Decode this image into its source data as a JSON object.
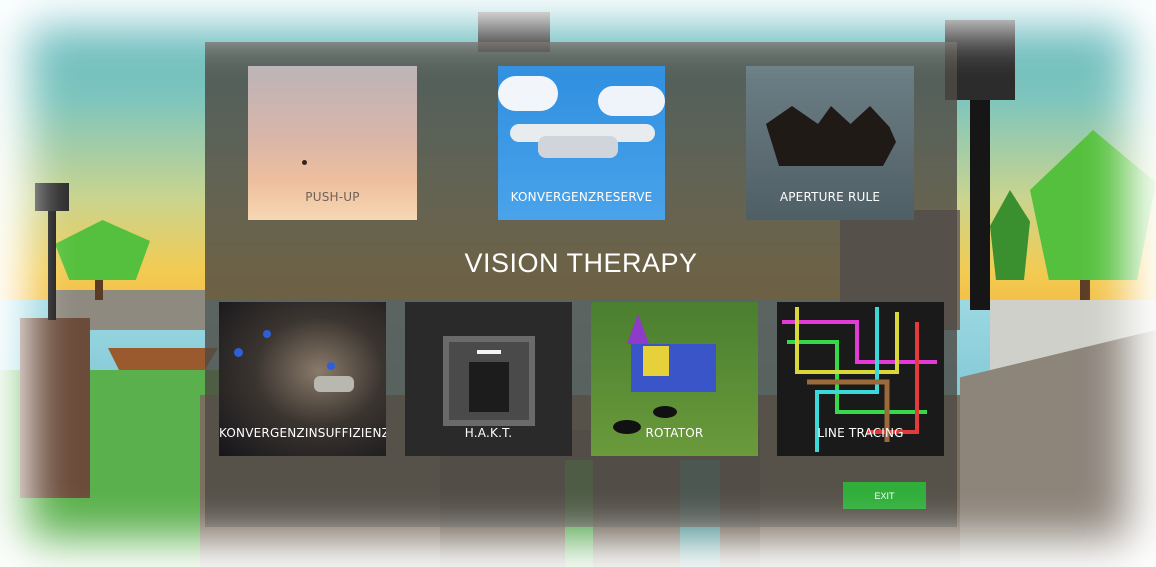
{
  "menu": {
    "title": "VISION THERAPY",
    "exit_label": "EXIT",
    "games_top": [
      {
        "label": "PUSH-UP"
      },
      {
        "label": "KONVERGENZRESERVE"
      },
      {
        "label": "APERTURE RULE"
      }
    ],
    "games_bottom": [
      {
        "label": "KONVERGENZINSUFFIZIENZ"
      },
      {
        "label": "H.A.K.T."
      },
      {
        "label": "ROTATOR"
      },
      {
        "label": "LINE TRACING"
      }
    ]
  },
  "colors": {
    "panel": "#4e4a44",
    "exit_button": "#2fae3a",
    "title_text": "#ffffff"
  }
}
